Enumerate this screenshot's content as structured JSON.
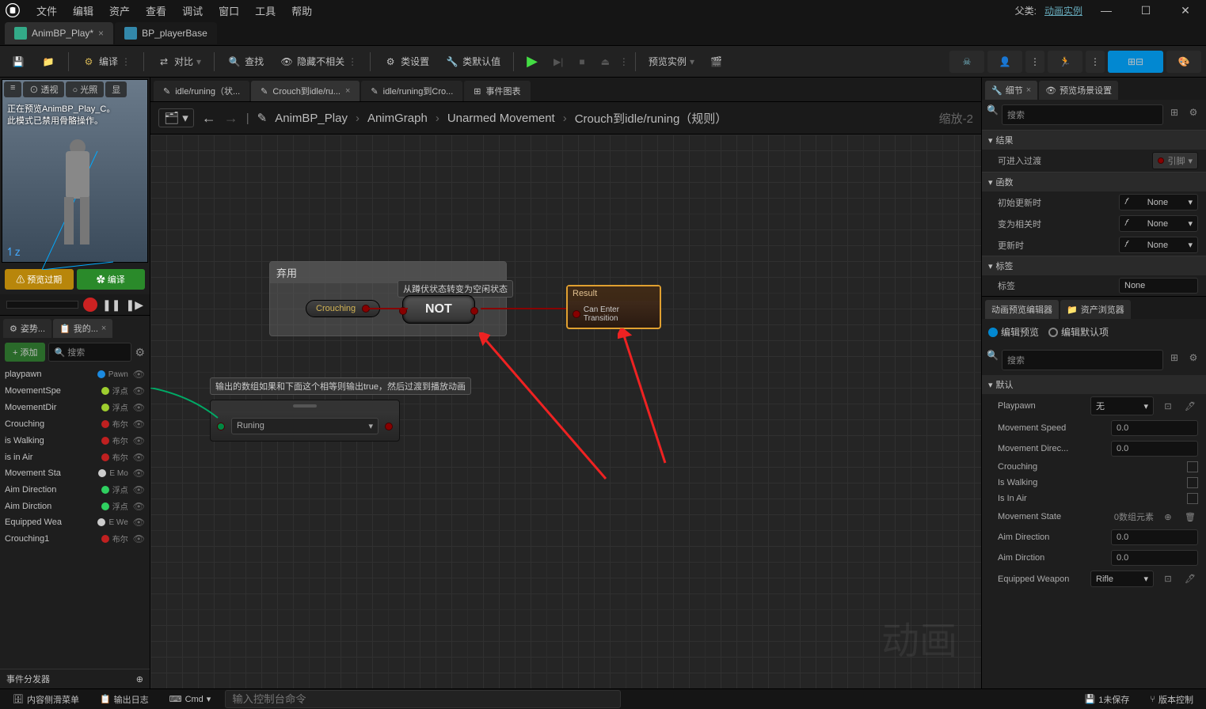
{
  "titlebar": {
    "menus": [
      "文件",
      "编辑",
      "资产",
      "查看",
      "调试",
      "窗口",
      "工具",
      "帮助"
    ],
    "parent_label": "父类:",
    "parent_value": "动画实例"
  },
  "filetabs": [
    {
      "label": "AnimBP_Play*",
      "active": true
    },
    {
      "label": "BP_playerBase",
      "active": false
    }
  ],
  "toolbar": {
    "compile": "编译",
    "diff": "对比",
    "find": "查找",
    "hide": "隐藏不相关",
    "classsettings": "类设置",
    "classdefaults": "类默认值",
    "preview_mode": "预览实例"
  },
  "viewport": {
    "pills": [
      "透视",
      "光照",
      "显"
    ],
    "overlay_l1": "正在预览AnimBP_Play_C。",
    "overlay_l2": "此模式已禁用骨骼操作。",
    "btn_preview": "⚠ 预览过期",
    "btn_compile": "✿ 编译"
  },
  "pose_tabs": {
    "t1": "姿势...",
    "t2": "我的..."
  },
  "pose_panel": {
    "add": "+ 添加",
    "search_ph": "搜索",
    "dispatcher": "事件分发器"
  },
  "variables": [
    {
      "name": "playpawn",
      "type": "Pawn",
      "color": "#1b8ae0"
    },
    {
      "name": "MovementSpe",
      "type": "浮点",
      "color": "#9ece2f"
    },
    {
      "name": "MovementDir",
      "type": "浮点",
      "color": "#9ece2f"
    },
    {
      "name": "Crouching",
      "type": "布尔",
      "color": "#c02020"
    },
    {
      "name": "is Walking",
      "type": "布尔",
      "color": "#c02020"
    },
    {
      "name": "is in Air",
      "type": "布尔",
      "color": "#c02020"
    },
    {
      "name": "Movement Sta",
      "type": "E Mo",
      "color": "#cccccc"
    },
    {
      "name": "Aim Direction",
      "type": "浮点",
      "color": "#2fd060"
    },
    {
      "name": "Aim Dirction",
      "type": "浮点",
      "color": "#2fd060"
    },
    {
      "name": "Equipped Wea",
      "type": "E We",
      "color": "#cccccc"
    },
    {
      "name": "Crouching1",
      "type": "布尔",
      "color": "#c02020"
    }
  ],
  "graph_tabs": [
    {
      "label": "idle/runing（状...",
      "active": false,
      "icon": "✎"
    },
    {
      "label": "Crouch到idle/ru...",
      "active": true,
      "icon": "✎"
    },
    {
      "label": "idle/runing到Cro...",
      "active": false,
      "icon": "✎"
    },
    {
      "label": "事件图表",
      "active": false,
      "icon": "⊞"
    }
  ],
  "breadcrumb": {
    "items": [
      "AnimBP_Play",
      "AnimGraph",
      "Unarmed Movement",
      "Crouch到idle/runing（规则）"
    ],
    "zoom": "缩放-2"
  },
  "nodes": {
    "comment1_title": "弃用",
    "tooltip1": "从蹲伏状态转变为空闲状态",
    "crouching_var": "Crouching",
    "not_label": "NOT",
    "result_title": "Result",
    "result_pin": "Can Enter Transition",
    "tooltip2": "输出的数组如果和下面这个相等则输出true，然后过渡到播放动画",
    "node2_select": "Runing"
  },
  "watermark": "动画",
  "details": {
    "tab_details": "细节",
    "tab_preview": "预览场景设置",
    "search_ph": "搜索",
    "sec_result": "结果",
    "can_transition": "可进入过渡",
    "can_transition_v": "引脚",
    "sec_func": "函数",
    "init_update": "初始更新时",
    "become_rel": "变为相关时",
    "on_update": "更新时",
    "none": "None",
    "sec_tag": "标签",
    "tag": "标签",
    "tag_v": "None"
  },
  "anim_preview": {
    "tab1": "动画预览编辑器",
    "tab2": "资产浏览器",
    "radio1": "编辑预览",
    "radio2": "编辑默认项",
    "search_ph": "搜索",
    "sec_default": "默认",
    "rows": [
      {
        "label": "Playpawn",
        "value": "无",
        "type": "select"
      },
      {
        "label": "Movement Speed",
        "value": "0.0",
        "type": "num"
      },
      {
        "label": "Movement Direc...",
        "value": "0.0",
        "type": "num"
      },
      {
        "label": "Crouching",
        "value": "",
        "type": "check"
      },
      {
        "label": "Is Walking",
        "value": "",
        "type": "check"
      },
      {
        "label": "Is In Air",
        "value": "",
        "type": "check"
      },
      {
        "label": "Movement State",
        "value": "0数组元素",
        "type": "array"
      },
      {
        "label": "Aim Direction",
        "value": "0.0",
        "type": "num"
      },
      {
        "label": "Aim Dirction",
        "value": "0.0",
        "type": "num"
      },
      {
        "label": "Equipped Weapon",
        "value": "Rifle",
        "type": "select"
      }
    ]
  },
  "statusbar": {
    "drawer": "内容侧滑菜单",
    "output": "输出日志",
    "cmd_label": "Cmd",
    "cmd_ph": "输入控制台命令",
    "unsaved": "1未保存",
    "version": "版本控制"
  }
}
